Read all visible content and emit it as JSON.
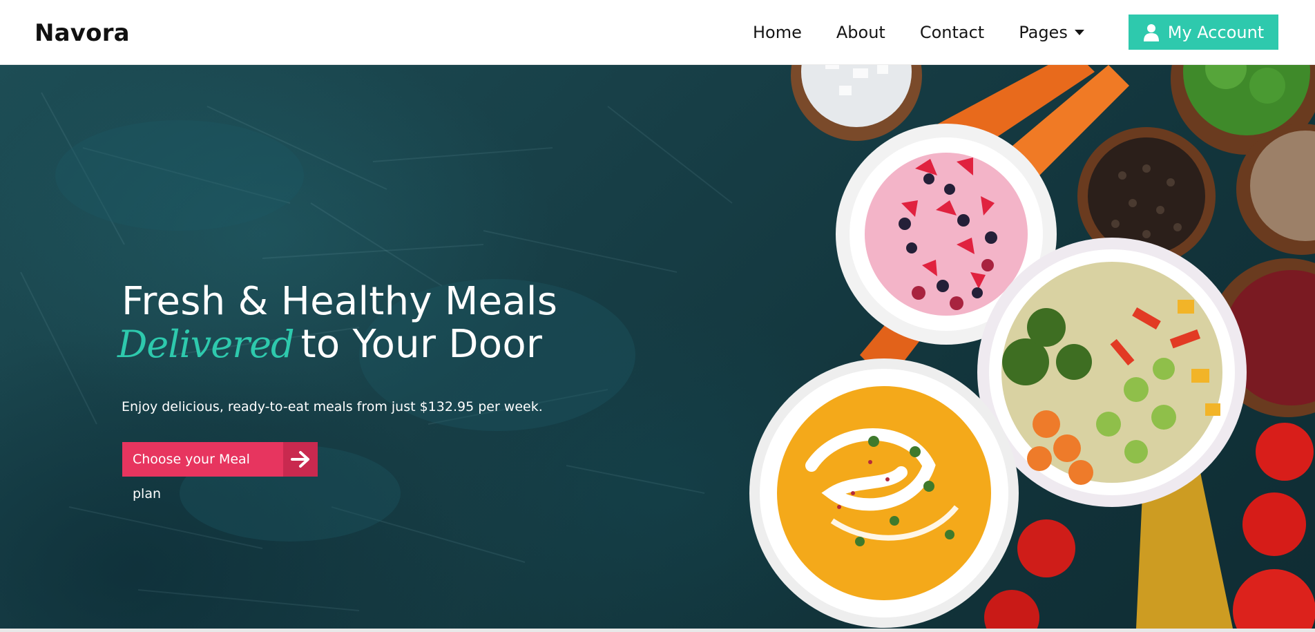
{
  "header": {
    "brand": "Navora",
    "nav": [
      {
        "label": "Home"
      },
      {
        "label": "About"
      },
      {
        "label": "Contact"
      },
      {
        "label": "Pages"
      }
    ],
    "account_label": "My Account",
    "account_icon": "user-icon",
    "accent_color": "#2ec9ad"
  },
  "hero": {
    "title_line1": "Fresh & Healthy Meals",
    "title_script": "Delivered",
    "title_line2_rest": "to Your Door",
    "subtitle": "Enjoy delicious, ready-to-eat meals from just $132.95 per week.",
    "cta_label": "Choose your Meal plan",
    "cta_icon": "arrow-right-icon",
    "cta_color": "#e7355f",
    "image": "food-bowls-image"
  }
}
